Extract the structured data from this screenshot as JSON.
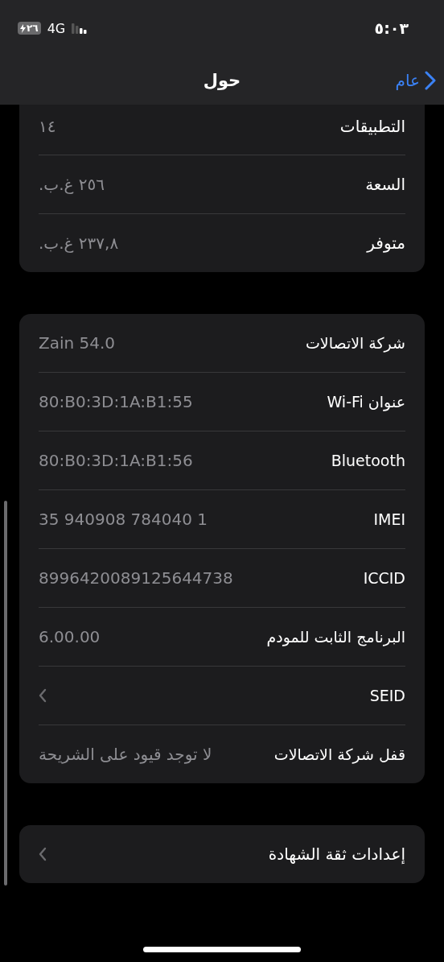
{
  "status_bar": {
    "time": "٥:٠٣",
    "network": "4G",
    "battery": "٢٦"
  },
  "nav_bar": {
    "back": "عام",
    "title": "حول"
  },
  "groups": [
    {
      "clipped": true,
      "rows": [
        {
          "kind": "value",
          "label": "التطبيقات",
          "value": "١٤"
        },
        {
          "kind": "value",
          "label": "السعة",
          "value": "٢٥٦ غ.ب."
        },
        {
          "kind": "value",
          "label": "متوفر",
          "value": "٢٣٧,٨ غ.ب."
        }
      ]
    },
    {
      "clipped": false,
      "rows": [
        {
          "kind": "value",
          "label": "شركة الاتصالات",
          "value": "Zain 54.0"
        },
        {
          "kind": "value",
          "label": "عنوان Wi-Fi",
          "value": "80:B0:3D:1A:B1:55"
        },
        {
          "kind": "value",
          "label": "Bluetooth",
          "value": "80:B0:3D:1A:B1:56"
        },
        {
          "kind": "value",
          "label": "IMEI",
          "value": "35 940908 784040 1"
        },
        {
          "kind": "value",
          "label": "ICCID",
          "value": "8996420089125644738"
        },
        {
          "kind": "value",
          "label": "البرنامج الثابت للمودم",
          "value": "6.00.00"
        },
        {
          "kind": "link",
          "label": "SEID"
        },
        {
          "kind": "value",
          "label": "قفل شركة الاتصالات",
          "value": "لا توجد قيود على الشريحة"
        }
      ]
    },
    {
      "clipped": false,
      "rows": [
        {
          "kind": "link",
          "label": "إعدادات ثقة الشهادة"
        }
      ]
    }
  ]
}
